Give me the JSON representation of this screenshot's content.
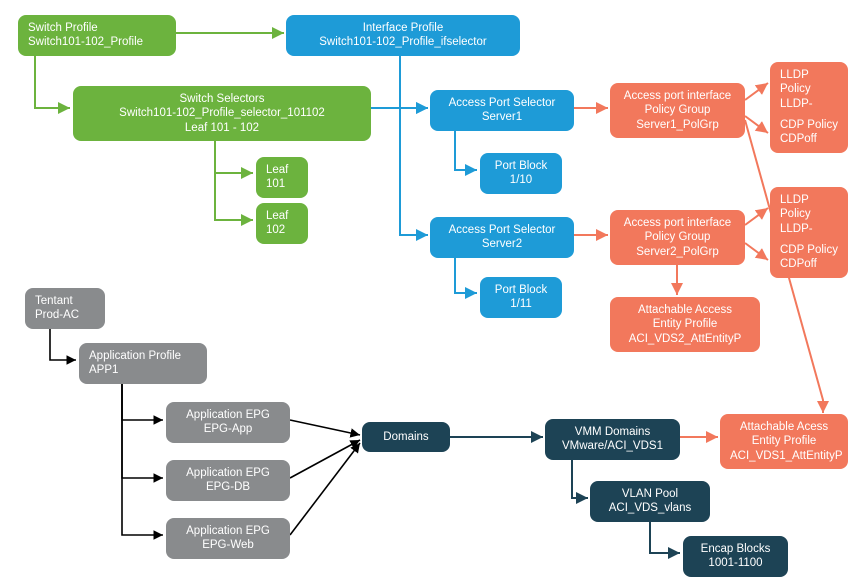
{
  "colors": {
    "green": "#6cb33e",
    "blue": "#1e9bd7",
    "orange": "#f2785c",
    "gray": "#898b8d",
    "navy": "#1d4355"
  },
  "nodes": {
    "switch_profile": {
      "l1": "Switch Profile",
      "l2": "Switch101-102_Profile"
    },
    "interface_profile": {
      "l1": "Interface Profile",
      "l2": "Switch101-102_Profile_ifselector"
    },
    "switch_selectors": {
      "l1": "Switch Selectors",
      "l2": "Switch101-102_Profile_selector_101102",
      "l3": "Leaf 101 - 102"
    },
    "leaf_101": {
      "l1": "Leaf",
      "l2": "101"
    },
    "leaf_102": {
      "l1": "Leaf",
      "l2": "102"
    },
    "aps_server1": {
      "l1": "Access Port Selector",
      "l2": "Server1"
    },
    "port_block_110": {
      "l1": "Port Block",
      "l2": "1/10"
    },
    "aps_server2": {
      "l1": "Access Port Selector",
      "l2": "Server2"
    },
    "port_block_111": {
      "l1": "Port Block",
      "l2": "1/11"
    },
    "apig_server1": {
      "l1": "Access port interface",
      "l2": "Policy Group",
      "l3": "Server1_PolGrp"
    },
    "apig_server2": {
      "l1": "Access port interface",
      "l2": "Policy Group",
      "l3": "Server2_PolGrp"
    },
    "lldp_1": {
      "l1": "LLDP Policy",
      "l2": "LLDP-Active"
    },
    "cdp_1": {
      "l1": "CDP Policy",
      "l2": "CDPoff"
    },
    "lldp_2": {
      "l1": "LLDP Policy",
      "l2": "LLDP-Active"
    },
    "cdp_2": {
      "l1": "CDP Policy",
      "l2": "CDPoff"
    },
    "aaep_vds2": {
      "l1": "Attachable Access",
      "l2": "Entity Profile",
      "l3": "ACI_VDS2_AttEntityP"
    },
    "aaep_vds1": {
      "l1": "Attachable Acess",
      "l2": "Entity Profile",
      "l3": "ACI_VDS1_AttEntityP"
    },
    "tenant": {
      "l1": "Tentant",
      "l2": "Prod-AC"
    },
    "app_profile": {
      "l1": "Application Profile",
      "l2": "APP1"
    },
    "epg_app": {
      "l1": "Application EPG",
      "l2": "EPG-App"
    },
    "epg_db": {
      "l1": "Application EPG",
      "l2": "EPG-DB"
    },
    "epg_web": {
      "l1": "Application EPG",
      "l2": "EPG-Web"
    },
    "domains": {
      "l1": "Domains"
    },
    "vmm": {
      "l1": "VMM Domains",
      "l2": "VMware/ACI_VDS1"
    },
    "vlan_pool": {
      "l1": "VLAN Pool",
      "l2": "ACI_VDS_vlans"
    },
    "encap": {
      "l1": "Encap Blocks",
      "l2": "1001-1100"
    }
  },
  "edges": [
    {
      "from": "switch_profile",
      "to": "interface_profile",
      "color": "green",
      "arrow": true
    },
    {
      "from": "switch_profile",
      "to": "switch_selectors",
      "color": "green",
      "arrow": true
    },
    {
      "from": "switch_selectors",
      "to": "leaf_101",
      "color": "green",
      "arrow": true
    },
    {
      "from": "switch_selectors",
      "to": "leaf_102",
      "color": "green",
      "arrow": true
    },
    {
      "from": "switch_selectors",
      "to": "aps_server1",
      "color": "blue",
      "arrow": true
    },
    {
      "from": "interface_profile",
      "to": "aps_server1",
      "color": "blue",
      "arrow": true
    },
    {
      "from": "interface_profile",
      "to": "aps_server2",
      "color": "blue",
      "arrow": true
    },
    {
      "from": "aps_server1",
      "to": "port_block_110",
      "color": "blue",
      "arrow": true
    },
    {
      "from": "aps_server2",
      "to": "port_block_111",
      "color": "blue",
      "arrow": true
    },
    {
      "from": "aps_server1",
      "to": "apig_server1",
      "color": "orange",
      "arrow": true
    },
    {
      "from": "aps_server2",
      "to": "apig_server2",
      "color": "orange",
      "arrow": true
    },
    {
      "from": "apig_server1",
      "to": "lldp_1",
      "color": "orange",
      "arrow": true
    },
    {
      "from": "apig_server1",
      "to": "cdp_1",
      "color": "orange",
      "arrow": true
    },
    {
      "from": "apig_server2",
      "to": "lldp_2",
      "color": "orange",
      "arrow": true
    },
    {
      "from": "apig_server2",
      "to": "cdp_2",
      "color": "orange",
      "arrow": true
    },
    {
      "from": "apig_server2",
      "to": "aaep_vds2",
      "color": "orange",
      "arrow": true
    },
    {
      "from": "apig_server1",
      "to": "aaep_vds1",
      "color": "orange",
      "arrow": true
    },
    {
      "from": "tenant",
      "to": "app_profile",
      "color": "black",
      "arrow": true
    },
    {
      "from": "app_profile",
      "to": "epg_app",
      "color": "black",
      "arrow": true
    },
    {
      "from": "app_profile",
      "to": "epg_db",
      "color": "black",
      "arrow": true
    },
    {
      "from": "app_profile",
      "to": "epg_web",
      "color": "black",
      "arrow": true
    },
    {
      "from": "epg_app",
      "to": "domains",
      "color": "black",
      "arrow": true
    },
    {
      "from": "epg_db",
      "to": "domains",
      "color": "black",
      "arrow": true
    },
    {
      "from": "epg_web",
      "to": "domains",
      "color": "black",
      "arrow": true
    },
    {
      "from": "domains",
      "to": "vmm",
      "color": "navy",
      "arrow": true
    },
    {
      "from": "vmm",
      "to": "vlan_pool",
      "color": "navy",
      "arrow": true
    },
    {
      "from": "vmm",
      "to": "aaep_vds1",
      "color": "orange",
      "arrow": true
    },
    {
      "from": "vlan_pool",
      "to": "encap",
      "color": "navy",
      "arrow": true
    }
  ]
}
